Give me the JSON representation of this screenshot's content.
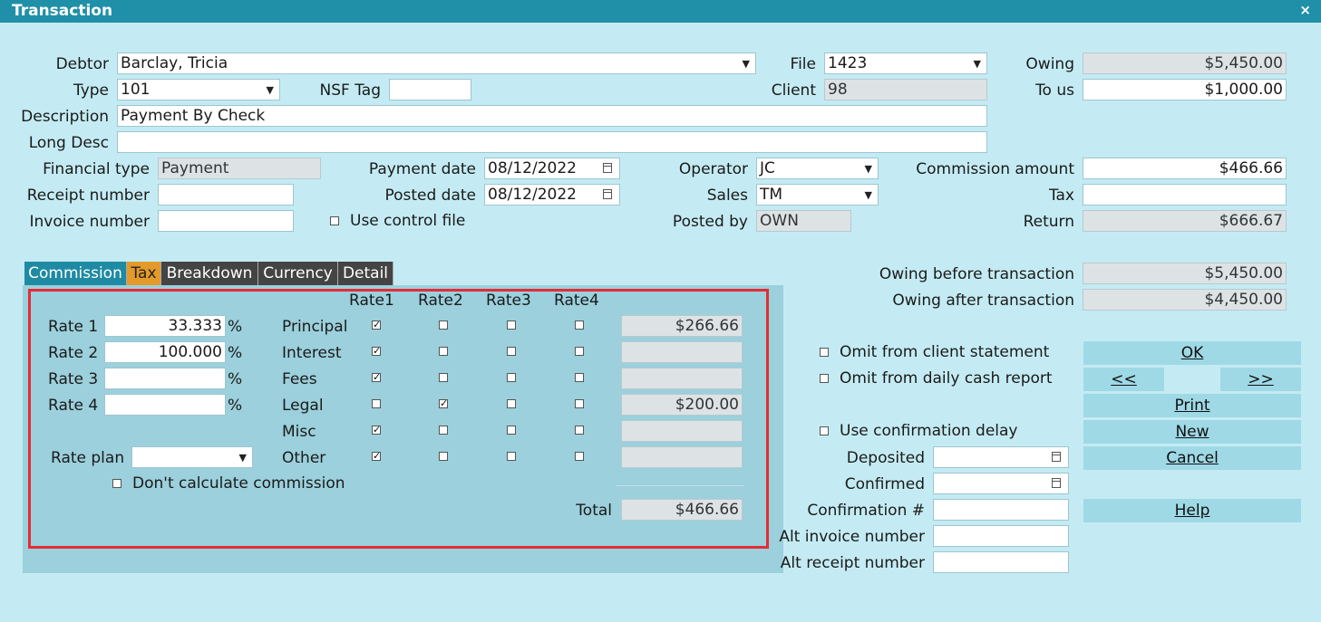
{
  "window": {
    "title": "Transaction",
    "close": "×"
  },
  "header": {
    "debtor_label": "Debtor",
    "debtor_value": "Barclay, Tricia",
    "file_label": "File",
    "file_value": "1423",
    "owing_label": "Owing",
    "owing_value": "$5,450.00",
    "type_label": "Type",
    "type_value": "101",
    "nsf_label": "NSF Tag",
    "nsf_value": "",
    "client_label": "Client",
    "client_value": "98",
    "tous_label": "To us",
    "tous_value": "$1,000.00",
    "description_label": "Description",
    "description_value": "Payment By Check",
    "longdesc_label": "Long Desc",
    "longdesc_value": "",
    "fintype_label": "Financial type",
    "fintype_value": "Payment",
    "paydate_label": "Payment date",
    "paydate_value": "08/12/2022",
    "operator_label": "Operator",
    "operator_value": "JC",
    "commamt_label": "Commission amount",
    "commamt_value": "$466.66",
    "receipt_label": "Receipt number",
    "receipt_value": "",
    "posted_label": "Posted date",
    "posted_value": "08/12/2022",
    "sales_label": "Sales",
    "sales_value": "TM",
    "tax_label": "Tax",
    "tax_value": "",
    "invoice_label": "Invoice number",
    "invoice_value": "",
    "usecontrol_label": "Use control file",
    "postedby_label": "Posted by",
    "postedby_value": "OWN",
    "return_label": "Return",
    "return_value": "$666.67"
  },
  "tabs": [
    "Commission",
    "Tax",
    "Breakdown",
    "Currency",
    "Detail"
  ],
  "commission": {
    "rate_headers": [
      "Rate1",
      "Rate2",
      "Rate3",
      "Rate4"
    ],
    "rates": [
      {
        "label": "Rate 1",
        "value": "33.333",
        "pct": "%"
      },
      {
        "label": "Rate 2",
        "value": "100.000",
        "pct": "%"
      },
      {
        "label": "Rate 3",
        "value": "",
        "pct": "%"
      },
      {
        "label": "Rate 4",
        "value": "",
        "pct": "%"
      }
    ],
    "rows": [
      {
        "label": "Principal",
        "checks": [
          true,
          false,
          false,
          false
        ],
        "amount": "$266.66"
      },
      {
        "label": "Interest",
        "checks": [
          true,
          false,
          false,
          false
        ],
        "amount": ""
      },
      {
        "label": "Fees",
        "checks": [
          true,
          false,
          false,
          false
        ],
        "amount": ""
      },
      {
        "label": "Legal",
        "checks": [
          false,
          true,
          false,
          false
        ],
        "amount": "$200.00"
      },
      {
        "label": "Misc",
        "checks": [
          true,
          false,
          false,
          false
        ],
        "amount": ""
      },
      {
        "label": "Other",
        "checks": [
          true,
          false,
          false,
          false
        ],
        "amount": ""
      }
    ],
    "rateplan_label": "Rate plan",
    "rateplan_value": "",
    "dontcalc_label": "Don't calculate commission",
    "total_label": "Total",
    "total_value": "$466.66"
  },
  "right": {
    "owing_before_label": "Owing before transaction",
    "owing_before_value": "$5,450.00",
    "owing_after_label": "Owing after transaction",
    "owing_after_value": "$4,450.00",
    "omit_client_label": "Omit from client statement",
    "omit_daily_label": "Omit from daily cash report",
    "use_confirm_label": "Use confirmation delay",
    "deposited_label": "Deposited",
    "deposited_value": "",
    "confirmed_label": "Confirmed",
    "confirmed_value": "",
    "confnum_label": "Confirmation #",
    "confnum_value": "",
    "altinvoice_label": "Alt invoice number",
    "altinvoice_value": "",
    "altreceipt_label": "Alt receipt number",
    "altreceipt_value": ""
  },
  "buttons": {
    "ok": "OK",
    "prev": "<<",
    "next": ">>",
    "print": "Print",
    "new": "New",
    "cancel": "Cancel",
    "help": "Help"
  }
}
